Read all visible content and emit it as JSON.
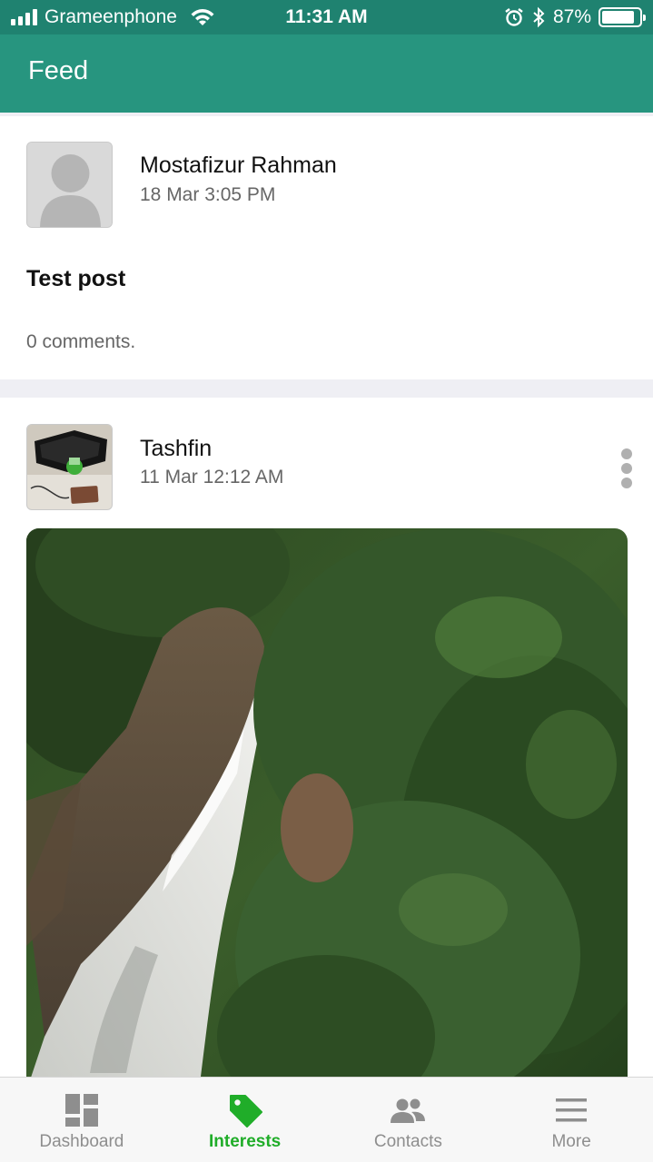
{
  "status_bar": {
    "carrier": "Grameenphone",
    "time": "11:31 AM",
    "battery_percent": "87%",
    "battery_level": 0.87
  },
  "nav": {
    "title": "Feed"
  },
  "feed": {
    "posts": [
      {
        "author": "Mostafizur Rahman",
        "timestamp": "18 Mar 3:05 PM",
        "text": "Test post",
        "comments": "0 comments."
      },
      {
        "author": "Tashfin",
        "timestamp": "11 Mar 12:12 AM"
      }
    ]
  },
  "tabbar": {
    "tabs": [
      {
        "label": "Dashboard",
        "icon": "dashboard-icon"
      },
      {
        "label": "Interests",
        "icon": "tag-icon"
      },
      {
        "label": "Contacts",
        "icon": "contacts-icon"
      },
      {
        "label": "More",
        "icon": "menu-icon"
      }
    ],
    "active": "Interests"
  },
  "colors": {
    "status_bar": "#1f8270",
    "nav_bar": "#27957f",
    "active_tab": "#20ad29",
    "inactive_tab": "#8e8e8e"
  }
}
